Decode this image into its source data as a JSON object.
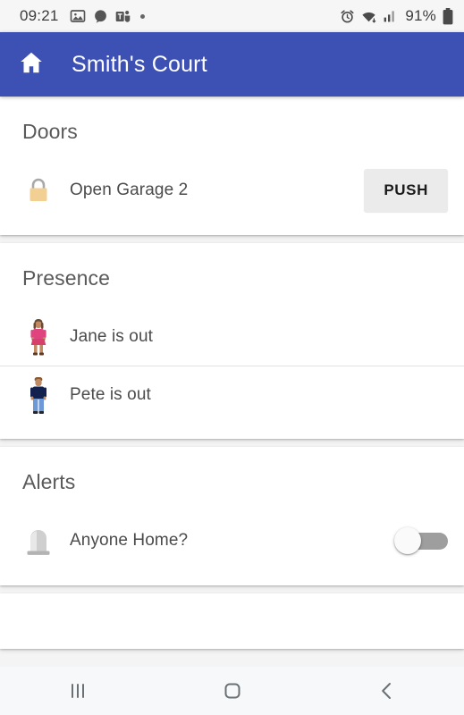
{
  "status_bar": {
    "clock": "09:21",
    "left_icons": [
      "image-icon",
      "chat-bubble-icon",
      "teams-icon",
      "more-dot-icon"
    ],
    "right_icons": [
      "alarm-icon",
      "wifi-icon",
      "signal-icon",
      "battery-icon"
    ],
    "battery_text": "91%"
  },
  "app_bar": {
    "home_icon": "home-icon",
    "title": "Smith's Court",
    "color": "#3d51b5"
  },
  "sections": [
    {
      "title": "Doors",
      "rows": [
        {
          "icon": "lock-closed-emoji",
          "label": "Open Garage 2",
          "control": "button",
          "button_label": "PUSH"
        }
      ]
    },
    {
      "title": "Presence",
      "rows": [
        {
          "icon": "woman-standing-emoji",
          "label": "Jane is out",
          "control": "none"
        },
        {
          "icon": "man-standing-emoji",
          "label": "Pete is out",
          "control": "none"
        }
      ]
    },
    {
      "title": "Alerts",
      "rows": [
        {
          "icon": "police-light-emoji",
          "label": "Anyone Home?",
          "control": "toggle",
          "toggle_state": "off"
        }
      ]
    }
  ],
  "nav_bar": {
    "recents_icon": "recents-icon",
    "home_icon": "home-square-icon",
    "back_icon": "back-chevron-icon"
  }
}
